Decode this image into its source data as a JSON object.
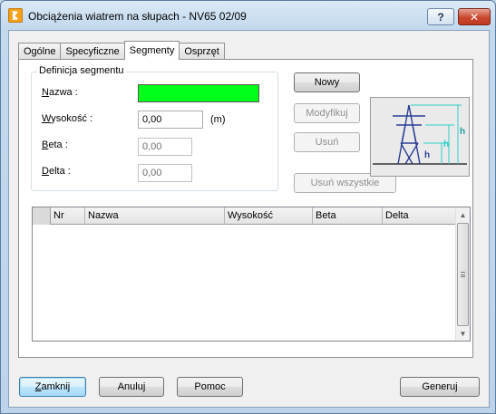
{
  "window": {
    "title": "Obciążenia wiatrem na słupach - NV65 02/09",
    "help_label": "?",
    "close_label": "✕"
  },
  "tabs": [
    {
      "label": "Ogólne",
      "active": false
    },
    {
      "label": "Specyficzne",
      "active": false
    },
    {
      "label": "Segmenty",
      "active": true
    },
    {
      "label": "Osprzęt",
      "active": false
    }
  ],
  "segment": {
    "legend": "Definicja segmentu",
    "nazwa_label": "Nazwa :",
    "nazwa_value": "",
    "nazwa_color": "#00ff19",
    "wysokosc_label": "Wysokość :",
    "wysokosc_value": "0,00",
    "wysokosc_unit": "(m)",
    "beta_label": "Beta :",
    "beta_value": "0,00",
    "delta_label": "Delta :",
    "delta_value": "0,00"
  },
  "actions": {
    "nowy": "Nowy",
    "modyfikuj": "Modyfikuj",
    "usun": "Usuń",
    "usun_wszystkie": "Usuń wszystkie"
  },
  "diagram": {
    "label_h": "h",
    "icon": "pylon-height-diagram"
  },
  "table": {
    "columns": [
      "Nr",
      "Nazwa",
      "Wysokość",
      "Beta",
      "Delta"
    ],
    "rows": []
  },
  "footer": {
    "zamknij": "Zamknij",
    "anuluj": "Anuluj",
    "pomoc": "Pomoc",
    "generuj": "Generuj"
  }
}
